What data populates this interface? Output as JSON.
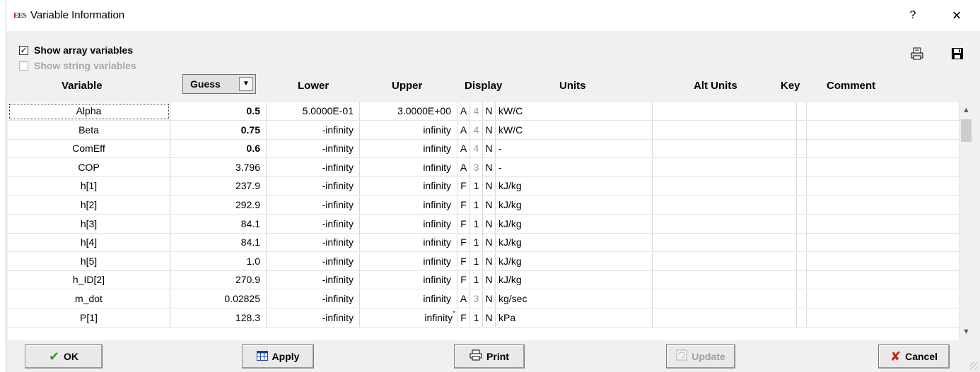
{
  "window": {
    "title": "Variable Information",
    "help_label": "?",
    "close_label": "×"
  },
  "options": {
    "show_array_label": "Show array variables",
    "show_array_checked": true,
    "show_string_label": "Show string variables",
    "show_string_checked": false
  },
  "columns": {
    "variable": "Variable",
    "guess": "Guess",
    "lower": "Lower",
    "upper": "Upper",
    "display": "Display",
    "units": "Units",
    "alt_units": "Alt Units",
    "key": "Key",
    "comment": "Comment"
  },
  "rows": [
    {
      "variable": "Alpha",
      "guess": "0.5",
      "lower": "5.0000E-01",
      "upper": "3.0000E+00",
      "d1": "A",
      "d2": "4",
      "d3": "N",
      "units": "kW/C",
      "guess_bold": true,
      "d2_grey": true,
      "star": ""
    },
    {
      "variable": "Beta",
      "guess": "0.75",
      "lower": "-infinity",
      "upper": "infinity",
      "d1": "A",
      "d2": "4",
      "d3": "N",
      "units": "kW/C",
      "guess_bold": true,
      "d2_grey": true,
      "star": ""
    },
    {
      "variable": "ComEff",
      "guess": "0.6",
      "lower": "-infinity",
      "upper": "infinity",
      "d1": "A",
      "d2": "4",
      "d3": "N",
      "units": "-",
      "guess_bold": true,
      "d2_grey": true,
      "star": ""
    },
    {
      "variable": "COP",
      "guess": "3.796",
      "lower": "-infinity",
      "upper": "infinity",
      "d1": "A",
      "d2": "3",
      "d3": "N",
      "units": "-",
      "guess_bold": false,
      "d2_grey": true,
      "star": ""
    },
    {
      "variable": "h[1]",
      "guess": "237.9",
      "lower": "-infinity",
      "upper": "infinity",
      "d1": "F",
      "d2": "1",
      "d3": "N",
      "units": "kJ/kg",
      "guess_bold": false,
      "d2_grey": false,
      "star": ""
    },
    {
      "variable": "h[2]",
      "guess": "292.9",
      "lower": "-infinity",
      "upper": "infinity",
      "d1": "F",
      "d2": "1",
      "d3": "N",
      "units": "kJ/kg",
      "guess_bold": false,
      "d2_grey": false,
      "star": ""
    },
    {
      "variable": "h[3]",
      "guess": "84.1",
      "lower": "-infinity",
      "upper": "infinity",
      "d1": "F",
      "d2": "1",
      "d3": "N",
      "units": "kJ/kg",
      "guess_bold": false,
      "d2_grey": false,
      "star": ""
    },
    {
      "variable": "h[4]",
      "guess": "84.1",
      "lower": "-infinity",
      "upper": "infinity",
      "d1": "F",
      "d2": "1",
      "d3": "N",
      "units": "kJ/kg",
      "guess_bold": false,
      "d2_grey": false,
      "star": ""
    },
    {
      "variable": "h[5]",
      "guess": "1.0",
      "lower": "-infinity",
      "upper": "infinity",
      "d1": "F",
      "d2": "1",
      "d3": "N",
      "units": "kJ/kg",
      "guess_bold": false,
      "d2_grey": false,
      "star": ""
    },
    {
      "variable": "h_ID[2]",
      "guess": "270.9",
      "lower": "-infinity",
      "upper": "infinity",
      "d1": "F",
      "d2": "1",
      "d3": "N",
      "units": "kJ/kg",
      "guess_bold": false,
      "d2_grey": false,
      "star": ""
    },
    {
      "variable": "m_dot",
      "guess": "0.02825",
      "lower": "-infinity",
      "upper": "infinity",
      "d1": "A",
      "d2": "3",
      "d3": "N",
      "units": "kg/sec",
      "guess_bold": false,
      "d2_grey": true,
      "star": ""
    },
    {
      "variable": "P[1]",
      "guess": "128.3",
      "lower": "-infinity",
      "upper": "infinity",
      "d1": "F",
      "d2": "1",
      "d3": "N",
      "units": "kPa",
      "guess_bold": false,
      "d2_grey": false,
      "star": "*"
    }
  ],
  "buttons": {
    "ok": "OK",
    "apply": "Apply",
    "print": "Print",
    "update": "Update",
    "cancel": "Cancel"
  },
  "icons": {
    "app": "ees-app-icon",
    "print_preview": "print-preview-icon",
    "save": "floppy-disk-icon"
  },
  "colors": {
    "ok_check": "#2f9e1f",
    "cancel_x": "#d01818",
    "star": "#2a2ad0"
  }
}
